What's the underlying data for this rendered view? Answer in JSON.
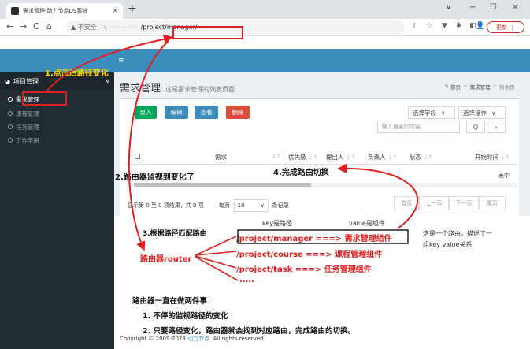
{
  "browser": {
    "tab_title": "需求管理-动力节点D9系统",
    "tab_close": "×",
    "new_tab": "+",
    "min": "−",
    "max": "☐",
    "close": "✕",
    "chevron": "∨",
    "security": "▲ 不安全",
    "url_partial": "/project/manager/",
    "update": "更新",
    "update_more": "⋮",
    "nav": {
      "back": "←",
      "forward": "→",
      "reload": "C",
      "home": "⌂"
    }
  },
  "app": {
    "menu_toggle": "≡",
    "page_title": "需求管理",
    "page_subtitle": "这是需求管理的列表页面",
    "breadcrumb": [
      "首页",
      ">",
      "需求管理",
      ">",
      "列表页"
    ]
  },
  "sidebar": {
    "group_label": "项目管理",
    "group_caret": "∨",
    "items": [
      "需求管理",
      "课程管理",
      "任务管理",
      "工作手册"
    ]
  },
  "toolbar": {
    "add": "录入",
    "edit": "编辑",
    "view": "查看",
    "delete": "删除",
    "field_select": "选择字段",
    "op_select": "选择操作",
    "search_placeholder": "输入搜索的内容",
    "search_icon": "Q",
    "more_icon": "»",
    "add_color": "#00a65a",
    "edit_color": "#3c8dbc",
    "view_color": "#3c8dbc",
    "delete_color": "#dd4b39"
  },
  "table": {
    "columns": [
      "需求",
      "优先级",
      "提出人",
      "负责人",
      "状态",
      "开始时间"
    ],
    "sort_glyph": "↓↑",
    "empty": "表中"
  },
  "pagination": {
    "info": "显示第 0 至 0 项结果，共 0 项",
    "per_page_label": "每页",
    "per_page_value": "10",
    "per_page_suffix": "条记录",
    "first": "首页",
    "prev": "上一页",
    "next": "下一页",
    "last": "尾页"
  },
  "annotations": {
    "step1": "1.点击后路径变化",
    "step2": "2.路由器监视到变化了",
    "step3": "3.根据路径匹配路由",
    "step4": "4.完成路由切换",
    "key_label": "key是路径",
    "value_label": "value是组件",
    "route1": "/project/manager ===> 需求管理组件",
    "route2": "/project/course ===> 课程管理组件",
    "route3": "/project/task ===> 任务管理组件",
    "ellipsis": ".....",
    "router": "路由器router",
    "side_note1": "这是一个路由，描述了一",
    "side_note2": "组key value关系",
    "summary_title": "路由器一直在做两件事：",
    "summary1": "1. 不停的监视路径的变化",
    "summary2": "2. 只要路径变化，路由器就会找到对应路由，完成路由的切换。"
  },
  "footer": {
    "prefix": "Copyright © 2009-2023 ",
    "brand": "动力节点",
    "suffix": ". All rights reserved."
  }
}
